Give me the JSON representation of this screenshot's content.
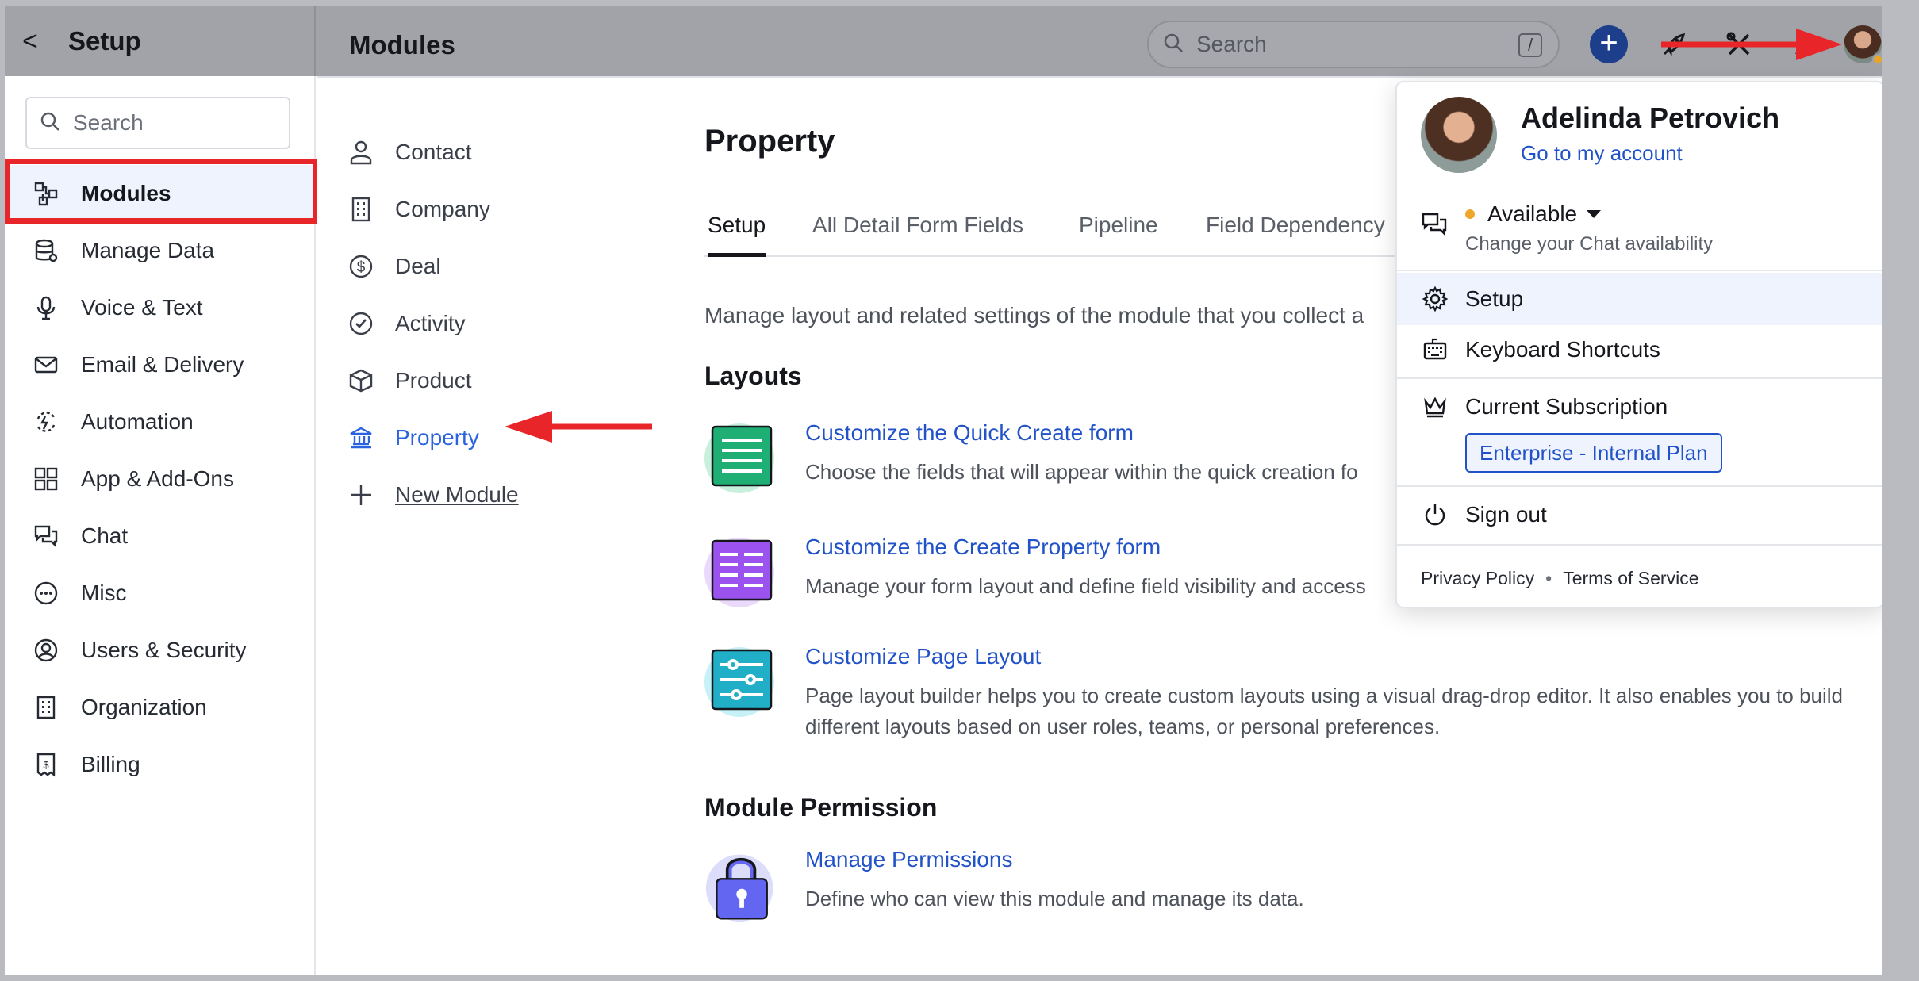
{
  "topbar": {
    "back_label": "<",
    "setup_title": "Setup",
    "modules_title": "Modules",
    "search_placeholder": "Search",
    "search_shortcut": "/",
    "add_label": "+"
  },
  "sidebar": {
    "search_placeholder": "Search",
    "items": [
      {
        "label": "Modules",
        "icon": "modules-icon"
      },
      {
        "label": "Manage Data",
        "icon": "database-icon"
      },
      {
        "label": "Voice & Text",
        "icon": "microphone-icon"
      },
      {
        "label": "Email & Delivery",
        "icon": "envelope-icon"
      },
      {
        "label": "Automation",
        "icon": "automation-icon"
      },
      {
        "label": "App & Add-Ons",
        "icon": "grid-icon"
      },
      {
        "label": "Chat",
        "icon": "chat-icon"
      },
      {
        "label": "Misc",
        "icon": "more-icon"
      },
      {
        "label": "Users & Security",
        "icon": "user-circle-icon"
      },
      {
        "label": "Organization",
        "icon": "building-icon"
      },
      {
        "label": "Billing",
        "icon": "receipt-icon"
      }
    ],
    "active": "Modules"
  },
  "modules": {
    "items": [
      {
        "label": "Contact",
        "icon": "person-icon"
      },
      {
        "label": "Company",
        "icon": "building-icon"
      },
      {
        "label": "Deal",
        "icon": "dollar-icon"
      },
      {
        "label": "Activity",
        "icon": "check-circle-icon"
      },
      {
        "label": "Product",
        "icon": "box-icon"
      },
      {
        "label": "Property",
        "icon": "bank-icon"
      },
      {
        "label": "New Module",
        "icon": "plus-icon"
      }
    ],
    "active": "Property"
  },
  "content": {
    "title": "Property",
    "tabs": [
      "Setup",
      "All Detail Form Fields",
      "Pipeline",
      "Field Dependency"
    ],
    "active_tab": "Setup",
    "description": "Manage layout and related settings of the module that you collect a",
    "layouts_heading": "Layouts",
    "cards": [
      {
        "title": "Customize the Quick Create form",
        "desc": "Choose the fields that will appear within the quick creation fo"
      },
      {
        "title": "Customize the Create Property form",
        "desc": "Manage your form layout and define field visibility and access"
      },
      {
        "title": "Customize Page Layout",
        "desc": "Page layout builder helps you to create custom layouts using a visual drag-drop editor. It also enables you to build different layouts based on user roles, teams, or personal preferences."
      }
    ],
    "permission_heading": "Module Permission",
    "permission_card": {
      "title": "Manage Permissions",
      "desc": "Define who can view this module and manage its data."
    }
  },
  "dropdown": {
    "name": "Adelinda Petrovich",
    "account_link": "Go to my account",
    "status": "Available",
    "status_hint": "Change your Chat availability",
    "setup": "Setup",
    "shortcuts": "Keyboard Shortcuts",
    "subscription": "Current Subscription",
    "plan": "Enterprise - Internal Plan",
    "sign_out": "Sign out",
    "privacy": "Privacy Policy",
    "terms": "Terms of Service"
  },
  "colors": {
    "accent": "#2152c8",
    "highlight_red": "#e8262a",
    "active_bg": "#eef3fe",
    "status_yellow": "#f0a52b"
  }
}
